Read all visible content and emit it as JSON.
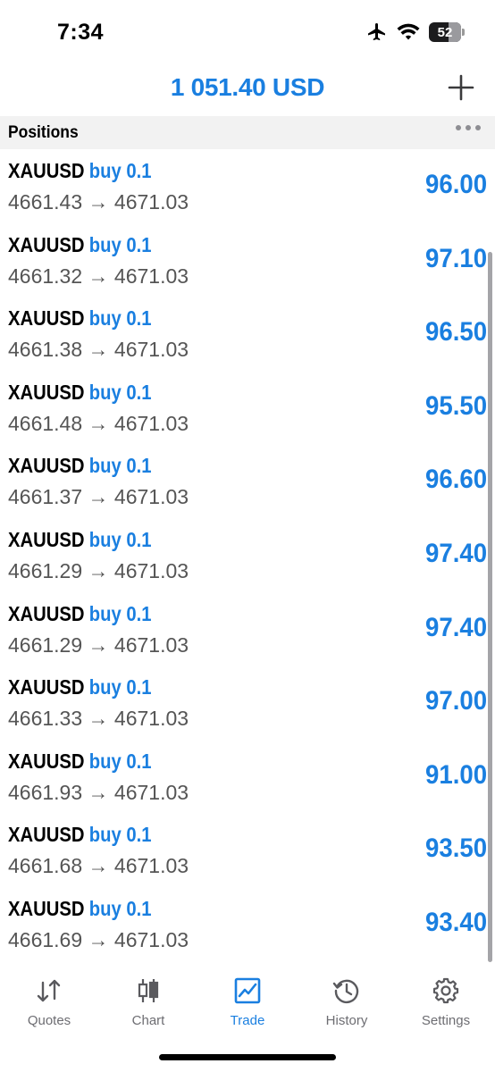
{
  "status_bar": {
    "time": "7:34",
    "battery": "52",
    "icons": [
      "airplane-icon",
      "wifi-icon",
      "battery-icon"
    ]
  },
  "header": {
    "balance": "1 051.40 USD",
    "add_icon": "plus-icon"
  },
  "section": {
    "title": "Positions",
    "more_icon": "ellipsis-icon"
  },
  "positions": [
    {
      "symbol": "XAUUSD",
      "side": "buy 0.1",
      "prices": "4661.43 → 4671.03",
      "profit": "96.00"
    },
    {
      "symbol": "XAUUSD",
      "side": "buy 0.1",
      "prices": "4661.32 → 4671.03",
      "profit": "97.10"
    },
    {
      "symbol": "XAUUSD",
      "side": "buy 0.1",
      "prices": "4661.38 → 4671.03",
      "profit": "96.50"
    },
    {
      "symbol": "XAUUSD",
      "side": "buy 0.1",
      "prices": "4661.48 → 4671.03",
      "profit": "95.50"
    },
    {
      "symbol": "XAUUSD",
      "side": "buy 0.1",
      "prices": "4661.37 → 4671.03",
      "profit": "96.60"
    },
    {
      "symbol": "XAUUSD",
      "side": "buy 0.1",
      "prices": "4661.29 → 4671.03",
      "profit": "97.40"
    },
    {
      "symbol": "XAUUSD",
      "side": "buy 0.1",
      "prices": "4661.29 → 4671.03",
      "profit": "97.40"
    },
    {
      "symbol": "XAUUSD",
      "side": "buy 0.1",
      "prices": "4661.33 → 4671.03",
      "profit": "97.00"
    },
    {
      "symbol": "XAUUSD",
      "side": "buy 0.1",
      "prices": "4661.93 → 4671.03",
      "profit": "91.00"
    },
    {
      "symbol": "XAUUSD",
      "side": "buy 0.1",
      "prices": "4661.68 → 4671.03",
      "profit": "93.50"
    },
    {
      "symbol": "XAUUSD",
      "side": "buy 0.1",
      "prices": "4661.69 → 4671.03",
      "profit": "93.40"
    }
  ],
  "tabs": [
    {
      "label": "Quotes",
      "icon": "quotes-arrows-icon",
      "active": false
    },
    {
      "label": "Chart",
      "icon": "candlestick-icon",
      "active": false
    },
    {
      "label": "Trade",
      "icon": "trade-chart-icon",
      "active": true
    },
    {
      "label": "History",
      "icon": "history-clock-icon",
      "active": false
    },
    {
      "label": "Settings",
      "icon": "gear-icon",
      "active": false
    }
  ],
  "colors": {
    "accent": "#1a7fe0",
    "section_bg": "#f2f2f2",
    "secondary_text": "#555555",
    "tab_inactive": "#6d6d72"
  }
}
